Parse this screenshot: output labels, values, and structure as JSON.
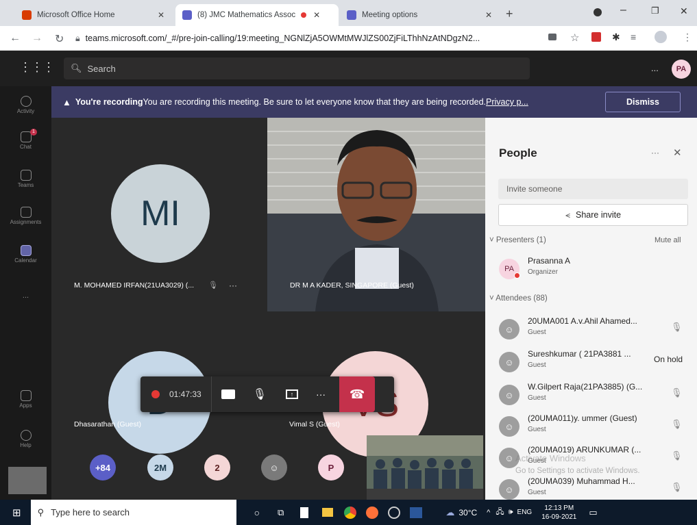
{
  "browser": {
    "tabs": [
      {
        "title": "Microsoft Office Home",
        "icon_color": "#d83b01"
      },
      {
        "title": "(8) JMC Mathematics Assoc",
        "icon_color": "#5b5fc7"
      },
      {
        "title": "Meeting options",
        "icon_color": "#5b5fc7"
      }
    ],
    "url": "teams.microsoft.com/_#/pre-join-calling/19:meeting_NGNlZjA5OWMtMWJlZS00ZjFiLThhNzAtNDgzN2..."
  },
  "teams": {
    "search_placeholder": "Search",
    "user_initials": "PA",
    "more_label": "...",
    "rail": [
      {
        "label": "Activity"
      },
      {
        "label": "Chat"
      },
      {
        "label": "Teams"
      },
      {
        "label": "Assignments"
      },
      {
        "label": "Calendar"
      },
      {
        "label": "..."
      },
      {
        "label": "Apps"
      },
      {
        "label": "Help"
      }
    ],
    "chat_badge": "1"
  },
  "banner": {
    "bold": "You're recording",
    "text": " You are recording this meeting. Be sure to let everyone know that they are being recorded. ",
    "link": "Privacy p...",
    "dismiss": "Dismiss"
  },
  "stage": {
    "tile1": {
      "initials": "MI",
      "name": "M. MOHAMED IRFAN(21UA3029) (..."
    },
    "tile2": {
      "name": "DR M A KADER, SINGAPORE (Guest)"
    },
    "tile3": {
      "initials": "D",
      "name": "Dhasarathan (Guest)"
    },
    "tile4": {
      "initials": "VS",
      "name": "Vimal S (Guest)"
    },
    "timer": "01:47:33",
    "more_dots": "···",
    "small_avatars": [
      {
        "label": "+84",
        "bg": "#5b5fc7",
        "fg": "#ffffff"
      },
      {
        "label": "2M",
        "bg": "#c6d8e8",
        "fg": "#1e3a4c"
      },
      {
        "label": "2",
        "bg": "#f4d6d6",
        "fg": "#5b1f1f"
      },
      {
        "label": "",
        "bg": "#7a7a7a",
        "fg": "#ffffff"
      },
      {
        "label": "P",
        "bg": "#f7d4e0",
        "fg": "#6b1f3b"
      }
    ]
  },
  "people": {
    "title": "People",
    "invite_placeholder": "Invite someone",
    "share_invite": "Share invite",
    "presenters_label": "Presenters (1)",
    "mute_all": "Mute all",
    "presenter": {
      "initials": "PA",
      "name": "Prasanna A",
      "role": "Organizer"
    },
    "attendees_label": "Attendees (88)",
    "attendees": [
      {
        "name": "20UMA001 A.v.Ahil Ahamed...",
        "role": "Guest",
        "status": ""
      },
      {
        "name": "Sureshkumar ( 21PA3881 ...",
        "role": "Guest",
        "status": "On hold"
      },
      {
        "name": "W.Gilpert Raja(21PA3885) (G...",
        "role": "Guest",
        "status": ""
      },
      {
        "name": "(20UMA011)y. ummer (Guest)",
        "role": "Guest",
        "status": ""
      },
      {
        "name": "(20UMA019) ARUNKUMAR (...",
        "role": "Guest",
        "status": ""
      },
      {
        "name": "(20UMA039) Muhammad H...",
        "role": "Guest",
        "status": ""
      }
    ],
    "watermark_line1": "Activate Windows",
    "watermark_line2": "Go to Settings to activate Windows."
  },
  "taskbar": {
    "search_placeholder": "Type here to search",
    "weather": "30°C",
    "lang": "ENG",
    "time": "12:13 PM",
    "date": "16-09-2021"
  }
}
